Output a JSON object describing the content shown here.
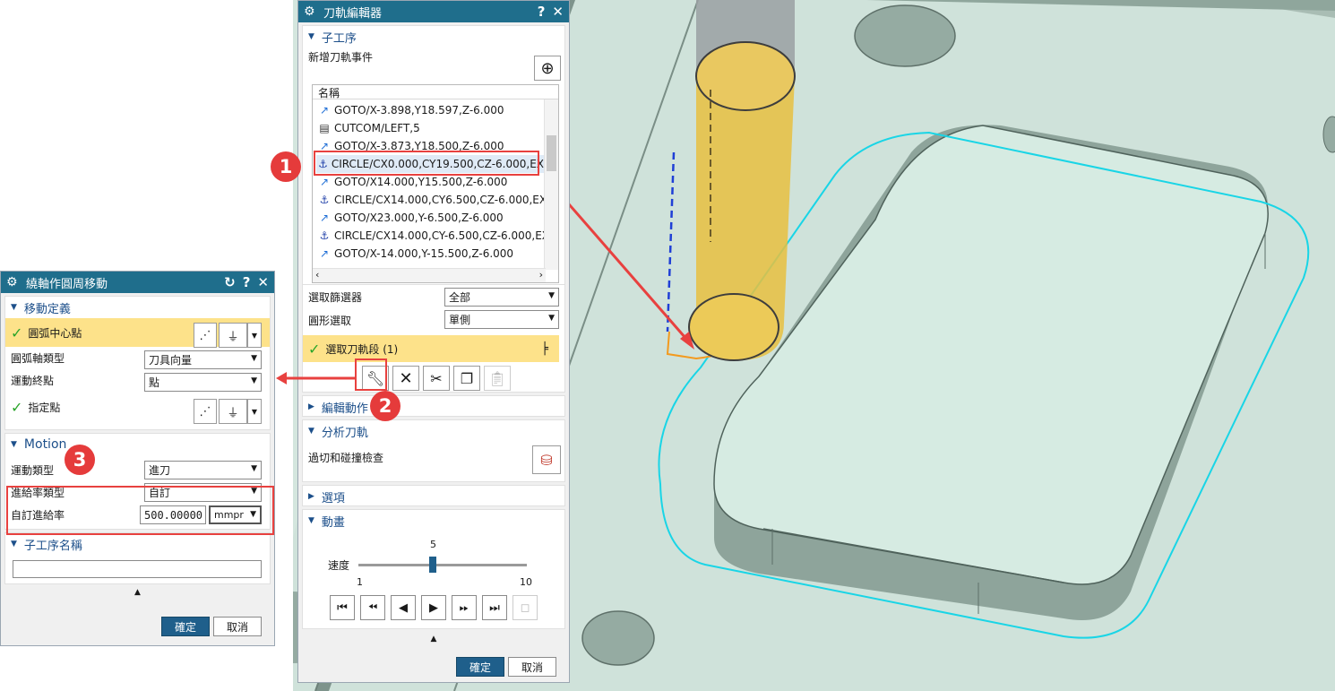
{
  "tool_path_editor": {
    "title": "刀軌編輯器",
    "help": "?",
    "close": "✕",
    "sub_operation": {
      "header": "子工序",
      "add_event_label": "新增刀軌事件"
    },
    "list": {
      "header": "名稱",
      "items": [
        {
          "icon": "goto-line-icon",
          "text": "GOTO/X-3.898,Y18.597,Z-6.000"
        },
        {
          "icon": "cutcom-icon",
          "text": "CUTCOM/LEFT,5"
        },
        {
          "icon": "goto-line-icon",
          "text": "GOTO/X-3.873,Y18.500,Z-6.000"
        },
        {
          "icon": "circle-arc-icon",
          "text": "CIRCLE/CX0.000,CY19.500,CZ-6.000,EX"
        },
        {
          "icon": "goto-line-icon",
          "text": "GOTO/X14.000,Y15.500,Z-6.000"
        },
        {
          "icon": "circle-arc-icon",
          "text": "CIRCLE/CX14.000,CY6.500,CZ-6.000,EX"
        },
        {
          "icon": "goto-line-icon",
          "text": "GOTO/X23.000,Y-6.500,Z-6.000"
        },
        {
          "icon": "circle-arc-icon",
          "text": "CIRCLE/CX14.000,CY-6.500,CZ-6.000,EX"
        },
        {
          "icon": "goto-line-icon",
          "text": "GOTO/X-14.000,Y-15.500,Z-6.000"
        }
      ]
    },
    "select_filter": {
      "label": "選取篩選器",
      "value": "全部"
    },
    "circle_select": {
      "label": "圓形選取",
      "value": "單側"
    },
    "select_segment": "選取刀軌段 (1)",
    "edit_actions": {
      "header": "編輯動作"
    },
    "analyze": {
      "header": "分析刀軌",
      "gouge_label": "過切和碰撞檢查"
    },
    "options": {
      "header": "選項"
    },
    "animation": {
      "header": "動畫",
      "speed_label": "速度",
      "speed_value": "5",
      "speed_min": "1",
      "speed_max": "10",
      "speed_fraction": 0.444
    },
    "ok": "確定",
    "cancel": "取消"
  },
  "rotate_dialog": {
    "title": "繞軸作圓周移動",
    "reset": "↻",
    "help": "?",
    "close": "✕",
    "move_def": {
      "header": "移動定義",
      "arc_center": "圓弧中心點",
      "arc_axis_type": {
        "label": "圓弧軸類型",
        "value": "刀具向量"
      },
      "move_end": {
        "label": "運動終點",
        "value": "點"
      },
      "specify_point": "指定點"
    },
    "motion": {
      "header": "Motion",
      "move_type": {
        "label": "運動類型",
        "value": "進刀"
      },
      "feed_type": {
        "label": "進給率類型",
        "value": "自訂"
      },
      "custom_feed": {
        "label": "自訂進給率",
        "value": "500.00000",
        "unit": "mmpr"
      }
    },
    "sub_op_name": {
      "header": "子工序名稱",
      "value": ""
    },
    "ok": "確定",
    "cancel": "取消"
  },
  "annotations": {
    "badge1": "1",
    "badge2": "2",
    "badge3": "3"
  },
  "colors": {
    "titlebar": "#1f6e8c",
    "highlight": "#fde28a",
    "annotation_red": "#e53b3b",
    "part_surface": "#c9ddd5",
    "toolpath_cyan": "#19d5e6",
    "tool_yellow": "#e7c040"
  }
}
